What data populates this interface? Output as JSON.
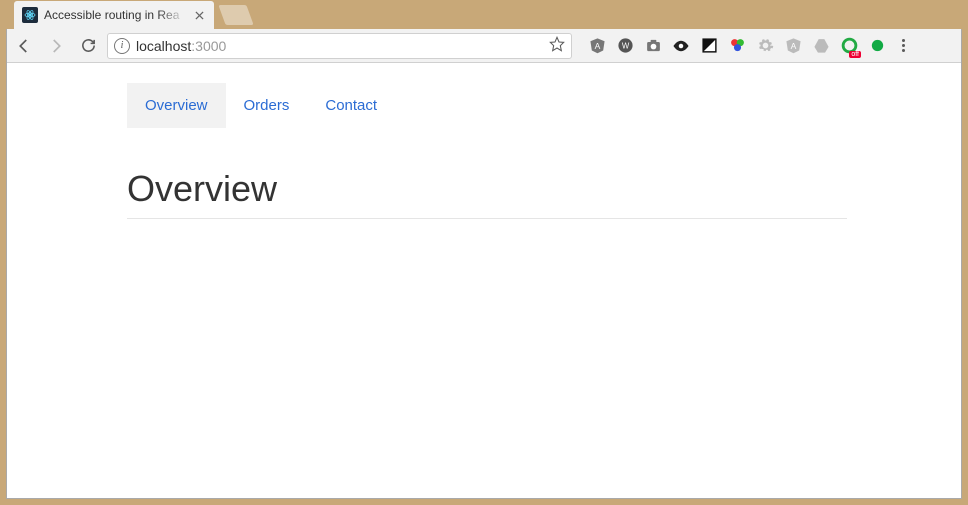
{
  "browser": {
    "tab": {
      "title": "Accessible routing in Rea"
    },
    "address": {
      "host": "localhost",
      "path": ":3000"
    },
    "extensions": {
      "angular": "A",
      "wappalyzer": "W",
      "camera": "cam",
      "eye": "eye",
      "contrast": "contrast",
      "colorful": "rgb",
      "gear1": "gear",
      "angular2": "A",
      "drive": "drive",
      "green_circle": "grn",
      "green_circle_badge": "off",
      "green_dot": "dot"
    }
  },
  "page": {
    "nav": {
      "items": [
        {
          "label": "Overview",
          "active": true
        },
        {
          "label": "Orders",
          "active": false
        },
        {
          "label": "Contact",
          "active": false
        }
      ]
    },
    "heading": "Overview"
  }
}
